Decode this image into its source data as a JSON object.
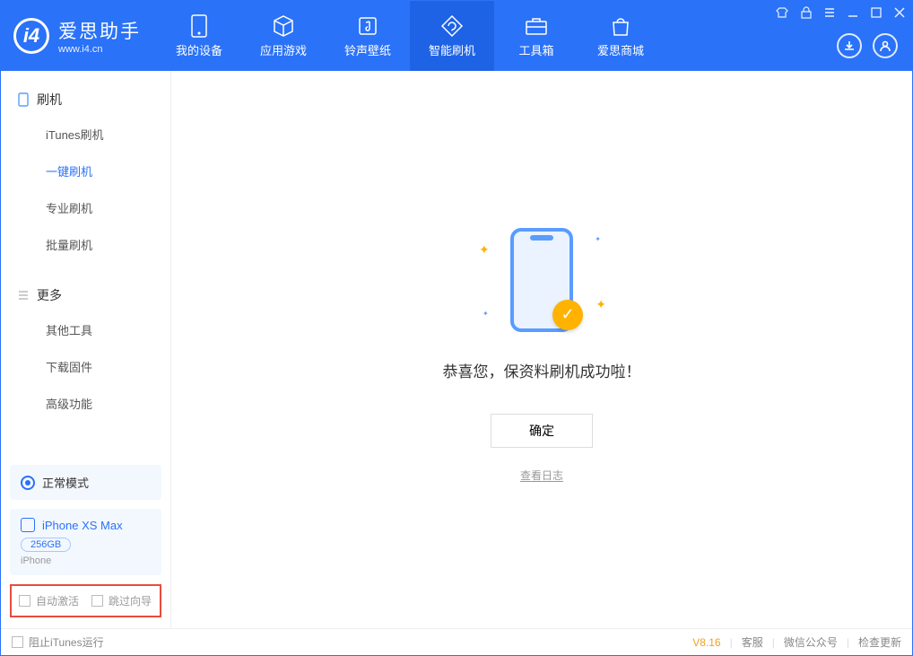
{
  "app": {
    "title": "爱思助手",
    "subtitle": "www.i4.cn"
  },
  "nav": {
    "items": [
      {
        "label": "我的设备",
        "icon": "device-icon"
      },
      {
        "label": "应用游戏",
        "icon": "cube-icon"
      },
      {
        "label": "铃声壁纸",
        "icon": "music-icon"
      },
      {
        "label": "智能刷机",
        "icon": "refresh-icon"
      },
      {
        "label": "工具箱",
        "icon": "toolbox-icon"
      },
      {
        "label": "爱思商城",
        "icon": "bag-icon"
      }
    ],
    "active_index": 3
  },
  "sidebar": {
    "section1": {
      "title": "刷机",
      "items": [
        {
          "label": "iTunes刷机"
        },
        {
          "label": "一键刷机"
        },
        {
          "label": "专业刷机"
        },
        {
          "label": "批量刷机"
        }
      ],
      "active_index": 1
    },
    "section2": {
      "title": "更多",
      "items": [
        {
          "label": "其他工具"
        },
        {
          "label": "下载固件"
        },
        {
          "label": "高级功能"
        }
      ]
    },
    "mode": {
      "label": "正常模式"
    },
    "device": {
      "name": "iPhone XS Max",
      "capacity": "256GB",
      "type": "iPhone"
    },
    "options": {
      "auto_activate": "自动激活",
      "skip_wizard": "跳过向导"
    }
  },
  "main": {
    "success_message": "恭喜您，保资料刷机成功啦！",
    "ok_button": "确定",
    "log_link": "查看日志"
  },
  "footer": {
    "block_itunes": "阻止iTunes运行",
    "version": "V8.16",
    "links": [
      "客服",
      "微信公众号",
      "检查更新"
    ]
  }
}
